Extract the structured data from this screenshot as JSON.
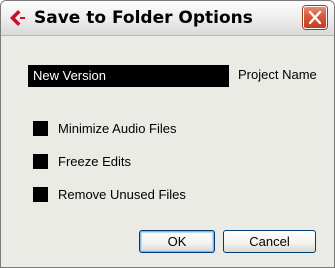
{
  "window": {
    "title": "Save to Folder Options",
    "logo_icon": "cubase-logo-icon",
    "close_icon": "close-icon",
    "close_color": "#d6583a"
  },
  "project_name": {
    "value": "New Version",
    "label": "Project Name"
  },
  "options": [
    {
      "label": "Minimize Audio Files",
      "checked": true
    },
    {
      "label": "Freeze Edits",
      "checked": true
    },
    {
      "label": "Remove Unused Files",
      "checked": true
    }
  ],
  "buttons": {
    "ok": "OK",
    "cancel": "Cancel"
  }
}
